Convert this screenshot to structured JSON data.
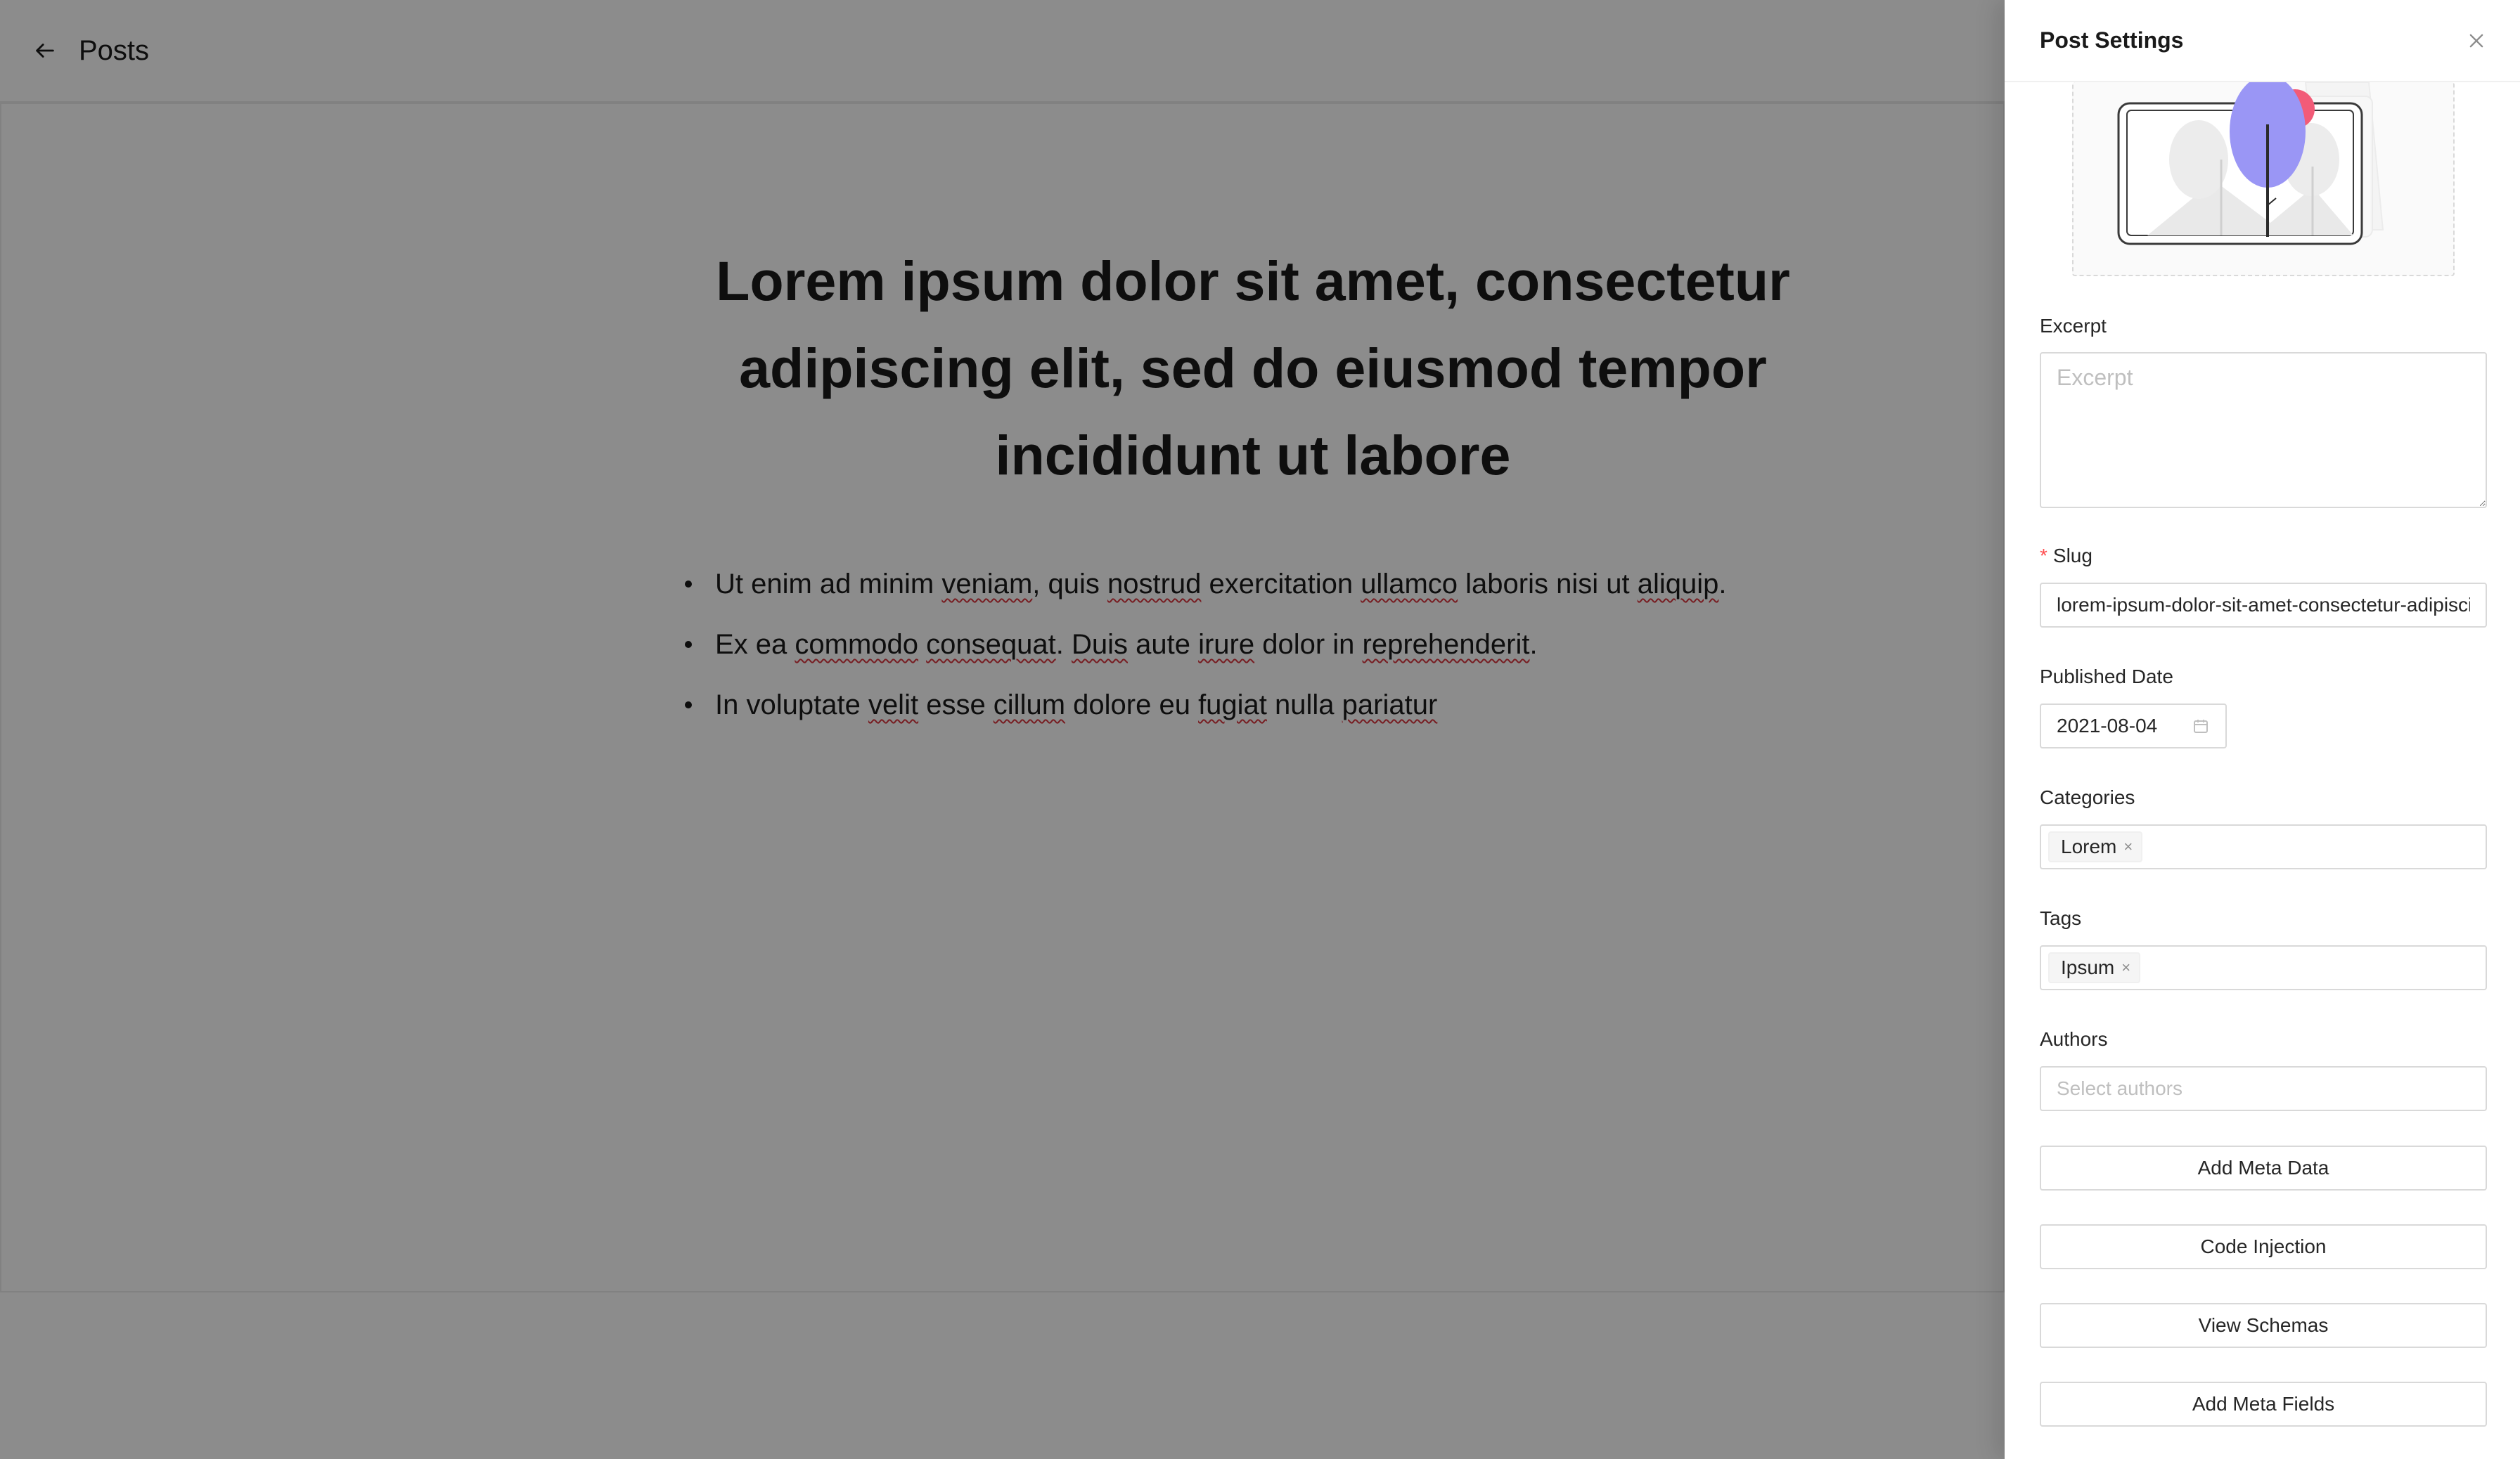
{
  "header": {
    "title": "Posts"
  },
  "post": {
    "title": "Lorem ipsum dolor sit amet, consectetur adipiscing elit, sed do eiusmod tempor incididunt ut labore",
    "list": [
      {
        "segments": [
          {
            "t": "Ut enim ad minim ",
            "sp": false
          },
          {
            "t": "veniam",
            "sp": true
          },
          {
            "t": ", quis ",
            "sp": false
          },
          {
            "t": "nostrud",
            "sp": true
          },
          {
            "t": " exercitation ",
            "sp": false
          },
          {
            "t": "ullamco",
            "sp": true
          },
          {
            "t": " laboris nisi ut ",
            "sp": false
          },
          {
            "t": "aliquip",
            "sp": true
          },
          {
            "t": ".",
            "sp": false
          }
        ]
      },
      {
        "segments": [
          {
            "t": " Ex ea ",
            "sp": false
          },
          {
            "t": "commodo",
            "sp": true
          },
          {
            "t": " ",
            "sp": false
          },
          {
            "t": "consequat",
            "sp": true
          },
          {
            "t": ". ",
            "sp": false
          },
          {
            "t": "Duis",
            "sp": true
          },
          {
            "t": " aute ",
            "sp": false
          },
          {
            "t": "irure",
            "sp": true
          },
          {
            "t": " dolor in ",
            "sp": false
          },
          {
            "t": "reprehenderit",
            "sp": true
          },
          {
            "t": ".",
            "sp": false
          }
        ]
      },
      {
        "segments": [
          {
            "t": " In voluptate ",
            "sp": false
          },
          {
            "t": "velit",
            "sp": true
          },
          {
            "t": " esse ",
            "sp": false
          },
          {
            "t": "cillum",
            "sp": true
          },
          {
            "t": " dolore eu ",
            "sp": false
          },
          {
            "t": "fugiat",
            "sp": true
          },
          {
            "t": " nulla ",
            "sp": false
          },
          {
            "t": "pariatur",
            "sp": true
          }
        ]
      }
    ]
  },
  "drawer": {
    "title": "Post Settings",
    "excerpt": {
      "label": "Excerpt",
      "placeholder": "Excerpt",
      "value": ""
    },
    "slug": {
      "label": "Slug",
      "required_mark": "*",
      "value": "lorem-ipsum-dolor-sit-amet-consectetur-adipiscing-elit-sed-do-eiusmod-tempor-incididunt-ut-labore"
    },
    "published_date": {
      "label": "Published Date",
      "value": "2021-08-04"
    },
    "categories": {
      "label": "Categories",
      "selected": [
        "Lorem"
      ],
      "remove_symbol": "×"
    },
    "tags": {
      "label": "Tags",
      "selected": [
        "Ipsum"
      ],
      "remove_symbol": "×"
    },
    "authors": {
      "label": "Authors",
      "placeholder": "Select authors"
    },
    "buttons": {
      "add_meta_data": "Add Meta Data",
      "code_injection": "Code Injection",
      "view_schemas": "View Schemas",
      "add_meta_fields": "Add Meta Fields"
    }
  },
  "colors": {
    "accent_purple": "#9a96f5",
    "accent_red": "#f25b78",
    "required": "#ff4d4f"
  }
}
